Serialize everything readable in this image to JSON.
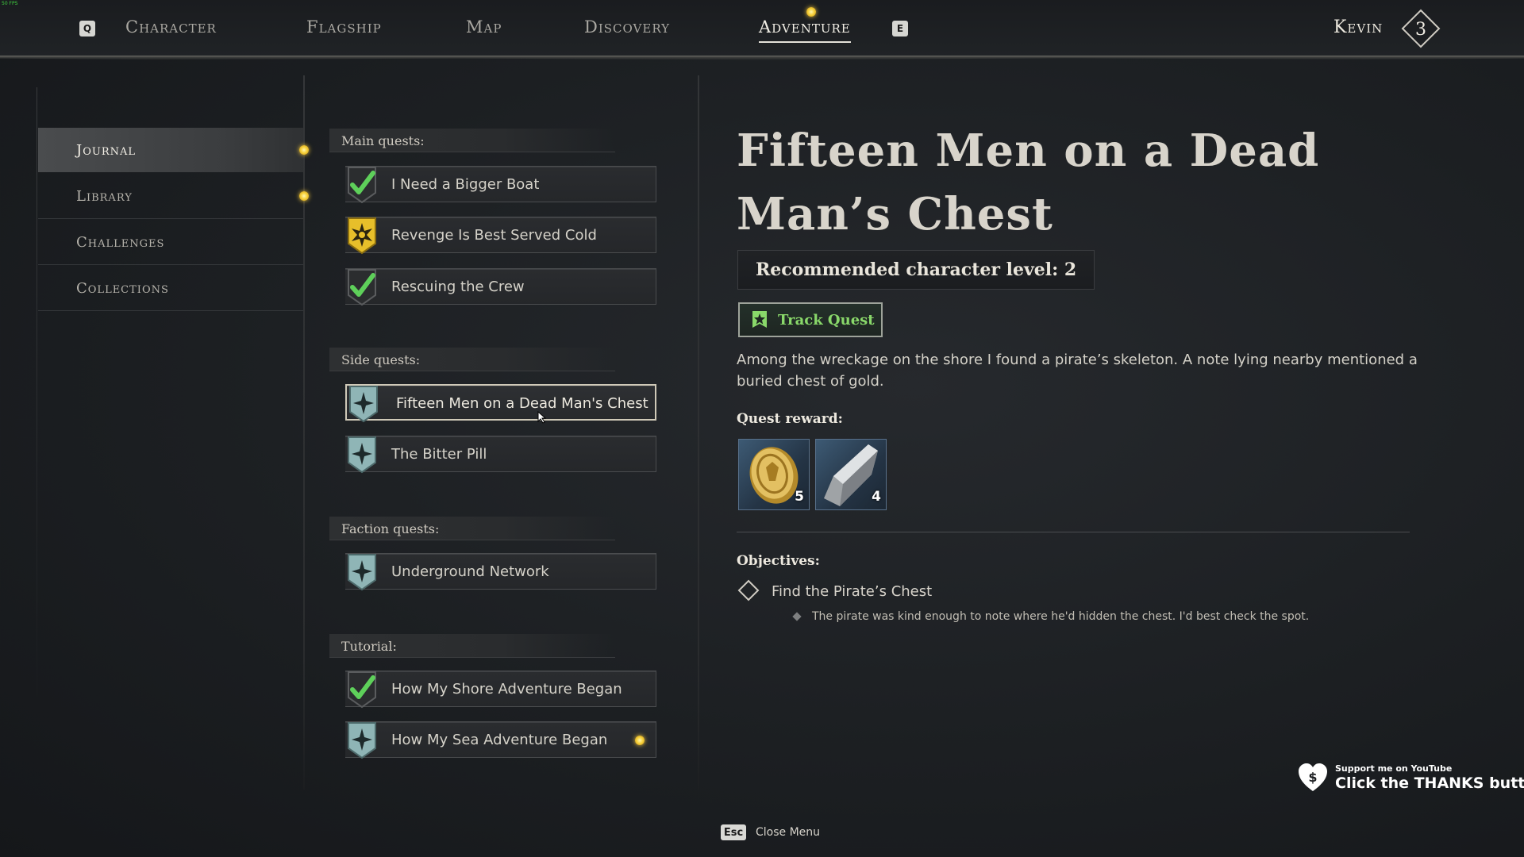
{
  "overlay": {
    "fps": "50 FPS"
  },
  "nav": {
    "left_key": "Q",
    "right_key": "E",
    "tabs": [
      "Character",
      "Flagship",
      "Map",
      "Discovery",
      "Adventure"
    ],
    "active_tab": "Adventure",
    "player": {
      "name": "Kevin",
      "level": "3"
    }
  },
  "sidebar": {
    "items": [
      {
        "label": "Journal",
        "active": true,
        "has_notification": true
      },
      {
        "label": "Library",
        "active": false,
        "has_notification": true
      },
      {
        "label": "Challenges",
        "active": false,
        "has_notification": false
      },
      {
        "label": "Collections",
        "active": false,
        "has_notification": false
      }
    ]
  },
  "quests": {
    "sections": [
      {
        "title": "Main quests:",
        "items": [
          {
            "label": "I Need a Bigger Boat",
            "status": "completed"
          },
          {
            "label": "Revenge Is Best Served Cold",
            "status": "tracked"
          },
          {
            "label": "Rescuing the Crew",
            "status": "completed"
          }
        ]
      },
      {
        "title": "Side quests:",
        "items": [
          {
            "label": "Fifteen Men on a Dead Man's Chest",
            "status": "active",
            "selected": true
          },
          {
            "label": "The Bitter Pill",
            "status": "active"
          }
        ]
      },
      {
        "title": "Faction quests:",
        "items": [
          {
            "label": "Underground Network",
            "status": "active"
          }
        ]
      },
      {
        "title": "Tutorial:",
        "items": [
          {
            "label": "How My Shore Adventure Began",
            "status": "completed"
          },
          {
            "label": "How My Sea Adventure Began",
            "status": "active",
            "new": true
          }
        ]
      }
    ]
  },
  "details": {
    "title": "Fifteen Men on a Dead Man’s Chest",
    "recommended_level": "Recommended character level: 2",
    "track_button": "Track Quest",
    "description": "Among the wreckage on the shore I found a pirate’s skeleton. A note lying nearby mentioned a buried chest of gold.",
    "reward_label": "Quest reward:",
    "rewards": [
      {
        "icon": "gold-coin-icon",
        "quantity": "5"
      },
      {
        "icon": "iron-ingot-icon",
        "quantity": "4"
      }
    ],
    "objectives_label": "Objectives:",
    "objective": "Find the Pirate’s Chest",
    "objective_note": "The pirate was kind enough to note where he'd hidden the chest. I'd best check the spot."
  },
  "support": {
    "small": "Support me on YouTube",
    "big": "Click the THANKS button"
  },
  "footer": {
    "key": "Esc",
    "label": "Close Menu"
  },
  "colors": {
    "notification_dot": "#f5c93a",
    "completed_check": "#5ed05a",
    "tracked_badge": "#e7bf2a",
    "active_badge": "#8fb5b6",
    "track_text": "#89d86a"
  }
}
